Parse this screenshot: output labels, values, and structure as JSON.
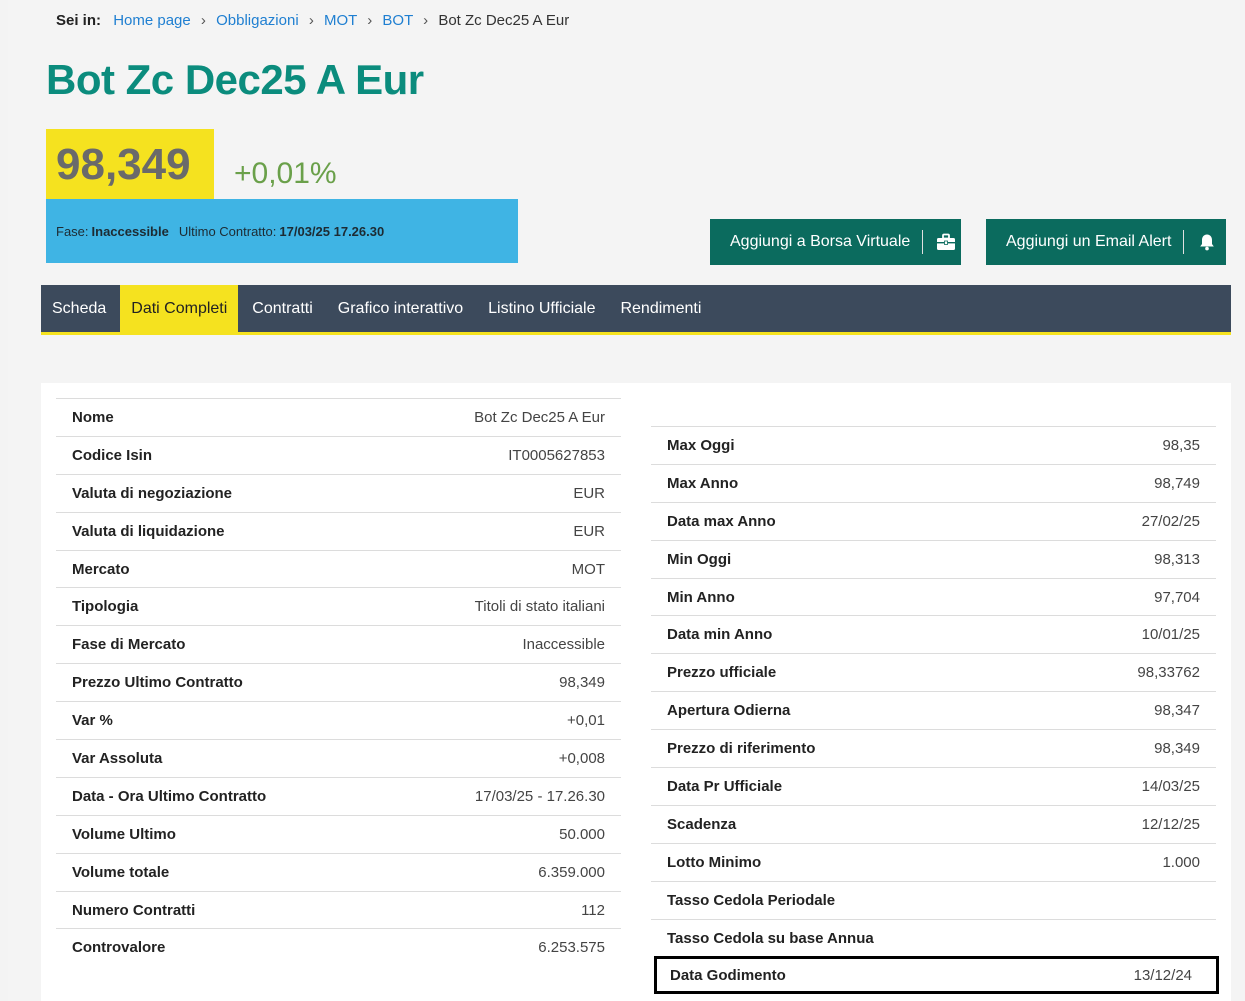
{
  "breadcrumb": {
    "lead": "Sei in:",
    "items": [
      "Home page",
      "Obbligazioni",
      "MOT",
      "BOT"
    ],
    "current": "Bot Zc Dec25 A Eur"
  },
  "title": "Bot Zc Dec25 A Eur",
  "price": "98,349",
  "var_pct": "+0,01%",
  "phase": {
    "label": "Fase:",
    "value": "Inaccessible",
    "last_label": "Ultimo Contratto:",
    "last_value": "17/03/25  17.26.30"
  },
  "buttons": {
    "borsa": "Aggiungi a Borsa Virtuale",
    "alert": "Aggiungi un Email Alert"
  },
  "tabs": [
    "Scheda",
    "Dati Completi",
    "Contratti",
    "Grafico interattivo",
    "Listino Ufficiale",
    "Rendimenti"
  ],
  "left_rows": [
    {
      "k": "Nome",
      "v": "Bot Zc Dec25 A Eur"
    },
    {
      "k": "Codice Isin",
      "v": "IT0005627853"
    },
    {
      "k": "Valuta di negoziazione",
      "v": "EUR"
    },
    {
      "k": "Valuta di liquidazione",
      "v": "EUR"
    },
    {
      "k": "Mercato",
      "v": "MOT"
    },
    {
      "k": "Tipologia",
      "v": "Titoli di stato italiani"
    },
    {
      "k": "Fase di Mercato",
      "v": "Inaccessible"
    },
    {
      "k": "Prezzo Ultimo Contratto",
      "v": "98,349"
    },
    {
      "k": "Var %",
      "v": "+0,01"
    },
    {
      "k": "Var Assoluta",
      "v": "+0,008"
    },
    {
      "k": "Data - Ora Ultimo Contratto",
      "v": "17/03/25 - 17.26.30"
    },
    {
      "k": "Volume Ultimo",
      "v": "50.000"
    },
    {
      "k": "Volume totale",
      "v": "6.359.000"
    },
    {
      "k": "Numero Contratti",
      "v": "112"
    },
    {
      "k": "Controvalore",
      "v": "6.253.575"
    }
  ],
  "right_rows": [
    {
      "k": "Max Oggi",
      "v": "98,35"
    },
    {
      "k": "Max Anno",
      "v": "98,749"
    },
    {
      "k": "Data max Anno",
      "v": "27/02/25"
    },
    {
      "k": "Min Oggi",
      "v": "98,313"
    },
    {
      "k": "Min Anno",
      "v": "97,704"
    },
    {
      "k": "Data min Anno",
      "v": "10/01/25"
    },
    {
      "k": "Prezzo ufficiale",
      "v": "98,33762"
    },
    {
      "k": "Apertura Odierna",
      "v": "98,347"
    },
    {
      "k": "Prezzo di riferimento",
      "v": "98,349"
    },
    {
      "k": "Data Pr Ufficiale",
      "v": "14/03/25"
    },
    {
      "k": "Scadenza",
      "v": "12/12/25"
    },
    {
      "k": "Lotto Minimo",
      "v": "1.000"
    },
    {
      "k": "Tasso Cedola Periodale",
      "v": ""
    },
    {
      "k": "Tasso Cedola su base Annua",
      "v": ""
    },
    {
      "k": "Data Godimento",
      "v": "13/12/24"
    }
  ]
}
